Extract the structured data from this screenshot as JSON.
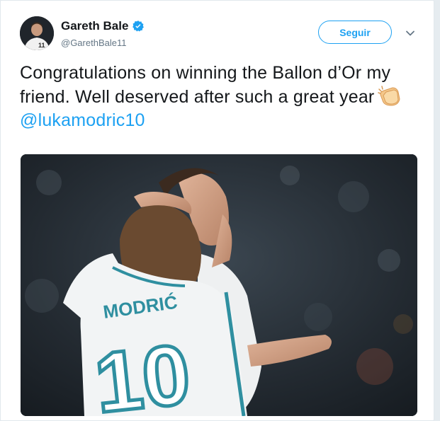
{
  "author": {
    "display_name": "Gareth Bale",
    "handle": "@GarethBale11",
    "verified": true,
    "verified_icon": "verified-badge-icon",
    "avatar_jersey_number": "11"
  },
  "actions": {
    "follow_label": "Seguir",
    "more_icon": "chevron-down-icon"
  },
  "tweet": {
    "text_main": "Congratulations on winning the Ballon d’Or my friend. Well deserved after such a great year",
    "emoji": "clapping-hands-icon",
    "mention": "@lukamodric10"
  },
  "media": {
    "jersey_name": "MODRIĆ",
    "jersey_number": "10"
  },
  "colors": {
    "accent": "#1da1f2",
    "text": "#14171a",
    "muted": "#657786",
    "jersey": "#f2f4f5",
    "jersey_trim": "#2f8fa0"
  }
}
